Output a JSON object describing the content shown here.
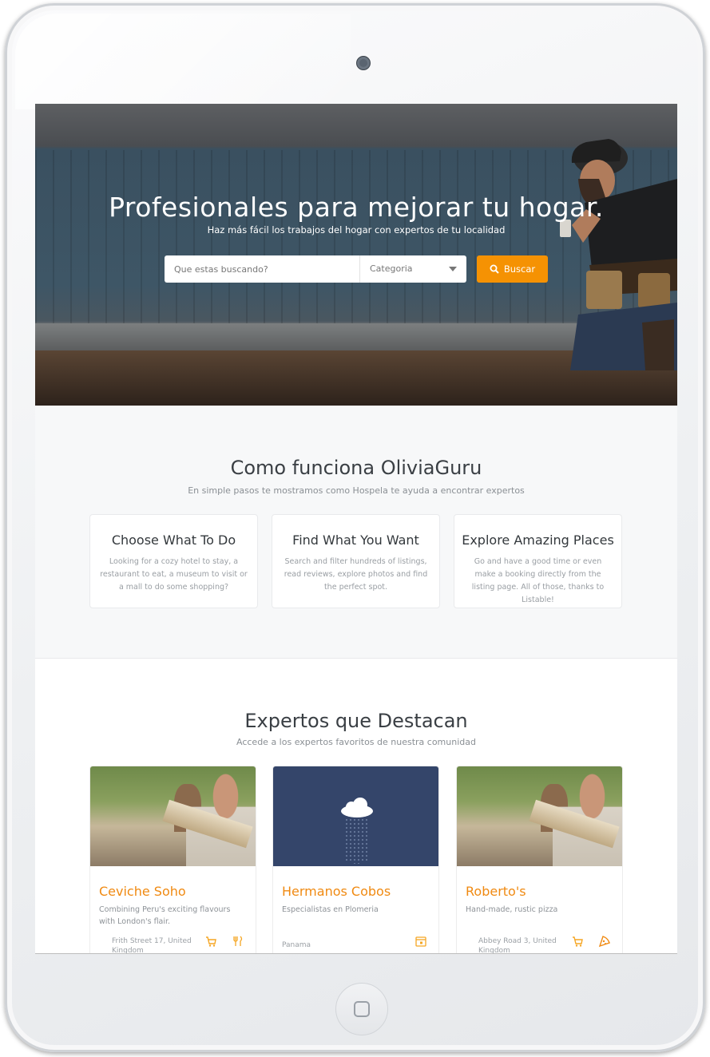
{
  "hero": {
    "title": "Profesionales para mejorar tu hogar.",
    "subtitle": "Haz más fácil los trabajos del hogar con expertos de tu localidad",
    "search_placeholder": "Que estas buscando?",
    "category_label": "Categoria",
    "search_button": "Buscar"
  },
  "how": {
    "title": "Como funciona OliviaGuru",
    "subtitle": "En simple pasos te mostramos como Hospela te ayuda a encontrar expertos",
    "steps": [
      {
        "title": "Choose What To Do",
        "desc": "Looking for a cozy hotel to stay, a restaurant to eat, a museum to visit or a mall to do some shopping?"
      },
      {
        "title": "Find What You Want",
        "desc": "Search and filter hundreds of listings, read reviews, explore photos and find the perfect spot."
      },
      {
        "title": "Explore Amazing Places",
        "desc": "Go and have a good time or even make a booking directly from the listing page. All of those, thanks to Listable!"
      }
    ]
  },
  "featured": {
    "title": "Expertos que Destacan",
    "subtitle": "Accede a los expertos favoritos de nuestra comunidad",
    "listings": [
      {
        "name": "Ceviche Soho",
        "desc": "Combining Peru's exciting flavours with London's flair.",
        "address": "Frith Street 17, United Kingdom",
        "icons": [
          "cart-icon",
          "food-icon"
        ]
      },
      {
        "name": "Hermanos Cobos",
        "desc": "Especialistas en Plomeria",
        "address": "Panama",
        "icons": [
          "calendar-icon"
        ]
      },
      {
        "name": "Roberto's",
        "desc": "Hand-made, rustic pizza",
        "address": "Abbey Road 3, United Kingdom",
        "icons": [
          "cart-icon",
          "pizza-icon"
        ]
      }
    ]
  },
  "colors": {
    "accent": "#f59203",
    "listing_name": "#f08a12",
    "cloud_card_bg": "#34456a"
  }
}
